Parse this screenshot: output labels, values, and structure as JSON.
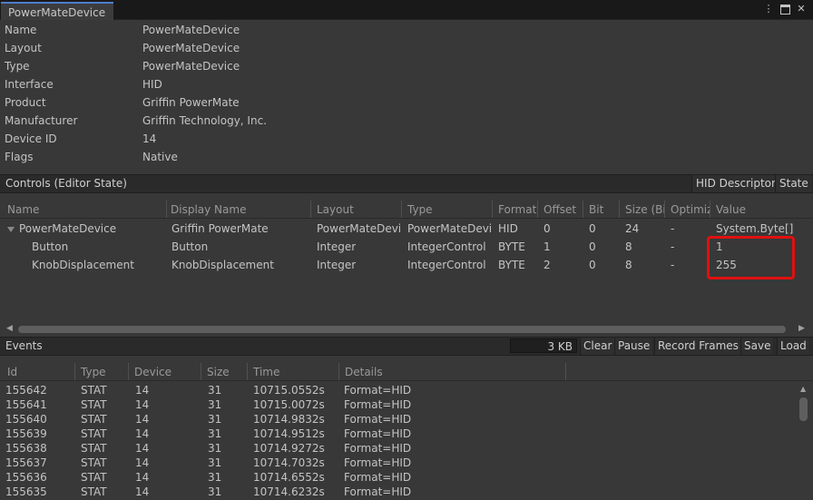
{
  "window": {
    "tab_title": "PowerMateDevice"
  },
  "properties": [
    {
      "key": "Name",
      "value": "PowerMateDevice"
    },
    {
      "key": "Layout",
      "value": "PowerMateDevice"
    },
    {
      "key": "Type",
      "value": "PowerMateDevice"
    },
    {
      "key": "Interface",
      "value": "HID"
    },
    {
      "key": "Product",
      "value": "Griffin PowerMate"
    },
    {
      "key": "Manufacturer",
      "value": "Griffin Technology, Inc."
    },
    {
      "key": "Device ID",
      "value": "14"
    },
    {
      "key": "Flags",
      "value": "Native"
    }
  ],
  "controls": {
    "title": "Controls (Editor State)",
    "hid_descriptor_label": "HID Descriptor",
    "state_label": "State",
    "columns": [
      "Name",
      "Display Name",
      "Layout",
      "Type",
      "Format",
      "Offset",
      "Bit",
      "Size (Bi",
      "Optimiz",
      "Value"
    ],
    "rows": [
      {
        "name": "PowerMateDevice",
        "display": "Griffin PowerMate",
        "layout": "PowerMateDevi",
        "type": "PowerMateDevi",
        "format": "HID",
        "offset": "0",
        "bit": "0",
        "size": "24",
        "optim": "-",
        "value": "System.Byte[]"
      },
      {
        "name": "Button",
        "display": "Button",
        "layout": "Integer",
        "type": "IntegerControl",
        "format": "BYTE",
        "offset": "1",
        "bit": "0",
        "size": "8",
        "optim": "-",
        "value": "1"
      },
      {
        "name": "KnobDisplacement",
        "display": "KnobDisplacement",
        "layout": "Integer",
        "type": "IntegerControl",
        "format": "BYTE",
        "offset": "2",
        "bit": "0",
        "size": "8",
        "optim": "-",
        "value": "255"
      }
    ]
  },
  "events": {
    "title": "Events",
    "size_value": "3 KB",
    "buttons": {
      "clear": "Clear",
      "pause": "Pause",
      "record": "Record Frames",
      "save": "Save",
      "load": "Load"
    },
    "columns": [
      "Id",
      "Type",
      "Device",
      "Size",
      "Time",
      "Details"
    ],
    "rows": [
      {
        "id": "155642",
        "type": "STAT",
        "device": "14",
        "size": "31",
        "time": "10715.0552s",
        "details": "Format=HID"
      },
      {
        "id": "155641",
        "type": "STAT",
        "device": "14",
        "size": "31",
        "time": "10715.0072s",
        "details": "Format=HID"
      },
      {
        "id": "155640",
        "type": "STAT",
        "device": "14",
        "size": "31",
        "time": "10714.9832s",
        "details": "Format=HID"
      },
      {
        "id": "155639",
        "type": "STAT",
        "device": "14",
        "size": "31",
        "time": "10714.9512s",
        "details": "Format=HID"
      },
      {
        "id": "155638",
        "type": "STAT",
        "device": "14",
        "size": "31",
        "time": "10714.9272s",
        "details": "Format=HID"
      },
      {
        "id": "155637",
        "type": "STAT",
        "device": "14",
        "size": "31",
        "time": "10714.7032s",
        "details": "Format=HID"
      },
      {
        "id": "155636",
        "type": "STAT",
        "device": "14",
        "size": "31",
        "time": "10714.6552s",
        "details": "Format=HID"
      },
      {
        "id": "155635",
        "type": "STAT",
        "device": "14",
        "size": "31",
        "time": "10714.6232s",
        "details": "Format=HID"
      }
    ]
  },
  "icons": {
    "menu": "kebab-menu-icon",
    "maximize": "maximize-icon",
    "close": "close-icon"
  }
}
